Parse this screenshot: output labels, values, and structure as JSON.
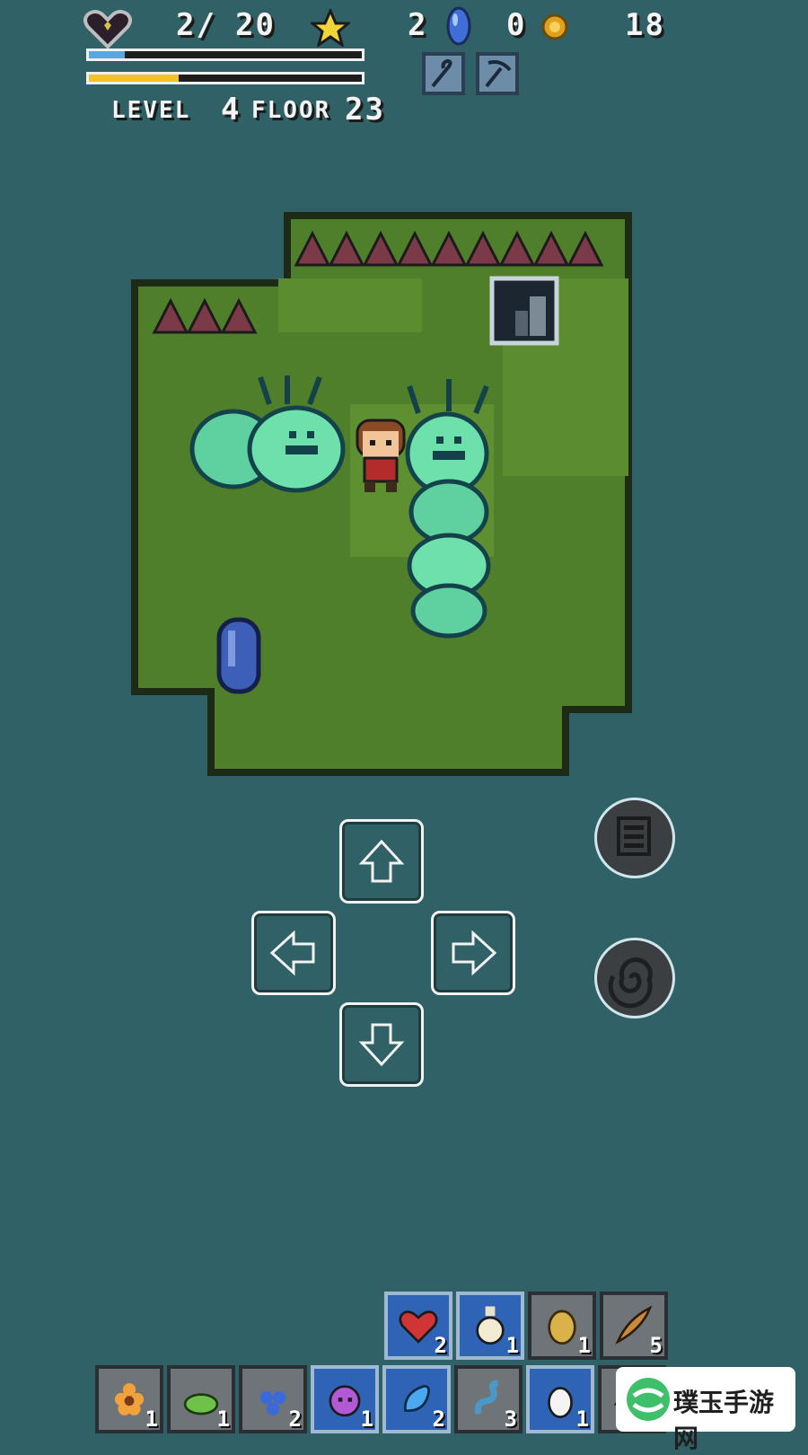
{
  "hud": {
    "hp_current": "2/",
    "hp_max": "20",
    "stars": "2",
    "gems": "0",
    "coins": "18",
    "xp_fraction": 0.13,
    "stamina_fraction": 0.33,
    "level_label": "LEVEL",
    "level": "4",
    "floor_label": "FLOOR",
    "floor": "23",
    "colors": {
      "xp": "#5aa6e0",
      "stamina": "#f2c22a"
    }
  },
  "tools": [
    {
      "name": "cane-icon"
    },
    {
      "name": "pickaxe-icon"
    }
  ],
  "board": {
    "enemies": [
      "caterpillar-monster",
      "caterpillar-monster"
    ],
    "player": "hero",
    "objects": [
      "stairs-down",
      "blue-capsule"
    ]
  },
  "controls": {
    "dpad": [
      "up",
      "left",
      "right",
      "down"
    ],
    "side_buttons": [
      "inventory-icon",
      "spiral-icon"
    ]
  },
  "inventory": {
    "top_row": [
      {
        "icon": "heart-icon",
        "count": "2",
        "selected": true
      },
      {
        "icon": "potion-icon",
        "count": "1",
        "selected": true
      },
      {
        "icon": "potato-icon",
        "count": "1",
        "selected": false
      },
      {
        "icon": "feather-icon",
        "count": "5",
        "selected": false
      }
    ],
    "bottom_row": [
      {
        "icon": "flower-icon",
        "count": "1",
        "selected": false
      },
      {
        "icon": "slime-icon",
        "count": "1",
        "selected": false
      },
      {
        "icon": "berries-icon",
        "count": "2",
        "selected": false
      },
      {
        "icon": "skull-jar-icon",
        "count": "1",
        "selected": true
      },
      {
        "icon": "blue-drop-icon",
        "count": "2",
        "selected": true
      },
      {
        "icon": "worm-icon",
        "count": "3",
        "selected": false
      },
      {
        "icon": "egg-icon",
        "count": "1",
        "selected": true
      },
      {
        "icon": "mushroom-icon",
        "count": "",
        "selected": false
      }
    ]
  },
  "watermark": {
    "text": "璞玉手游网"
  }
}
